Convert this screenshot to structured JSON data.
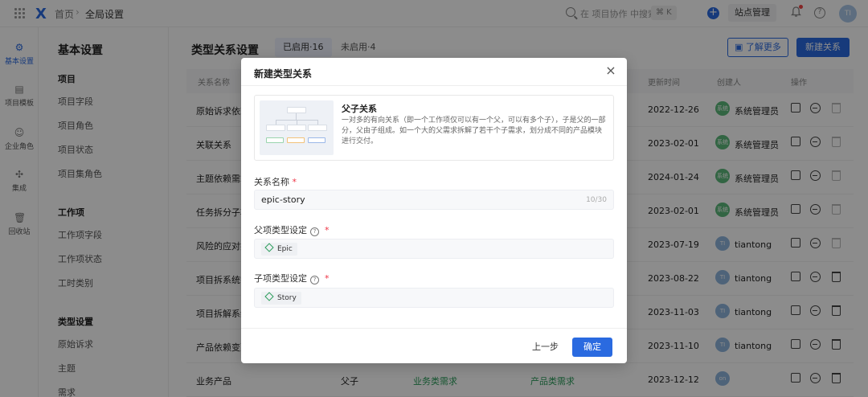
{
  "topbar": {
    "logo": "X",
    "breadcrumb_home": "首页",
    "breadcrumb_sep": "›",
    "breadcrumb_current": "全局设置",
    "search_placeholder": "在 项目协作 中搜索",
    "shortcut": "⌘ K",
    "plus": "+",
    "site_manage": "站点管理",
    "help": "?",
    "user_initials": "TI"
  },
  "rail": [
    {
      "label": "基本设置",
      "icon": "gear-icon",
      "glyph": "⚙",
      "active": true
    },
    {
      "label": "项目模板",
      "icon": "template-icon",
      "glyph": "▤",
      "active": false
    },
    {
      "label": "企业角色",
      "icon": "users-icon",
      "glyph": "☺",
      "active": false
    },
    {
      "label": "集成",
      "icon": "puzzle-icon",
      "glyph": "✣",
      "active": false
    },
    {
      "label": "回收站",
      "icon": "trash-icon",
      "glyph": "🗑",
      "active": false
    }
  ],
  "subnav": {
    "title": "基本设置",
    "groups": [
      {
        "name": "项目",
        "items": [
          "项目字段",
          "项目角色",
          "项目状态",
          "项目集角色"
        ]
      },
      {
        "name": "工作项",
        "items": [
          "工作项字段",
          "工作项状态",
          "工时类别"
        ]
      },
      {
        "name": "类型设置",
        "items": [
          "原始诉求",
          "主题",
          "需求"
        ]
      }
    ]
  },
  "main": {
    "title": "类型关系设置",
    "tab_enabled": "已启用·16",
    "tab_disabled": "未启用·4",
    "learn_more": "了解更多",
    "new_relation": "新建关系",
    "columns": {
      "name": "关系名称",
      "updated": "更新时间",
      "creator": "创建人",
      "ops": "操作"
    },
    "rows": [
      {
        "name": "原始诉求依赖",
        "rel": "",
        "parent": "",
        "child": "",
        "date": "2022-12-26",
        "av": "系统",
        "creator": "系统管理员",
        "av_color": "#5cb87a",
        "trash_dark": false
      },
      {
        "name": "关联关系",
        "rel": "",
        "parent": "",
        "child": "",
        "date": "2023-02-01",
        "av": "系统",
        "creator": "系统管理员",
        "av_color": "#5cb87a",
        "trash_dark": false
      },
      {
        "name": "主题依赖需求",
        "rel": "",
        "parent": "",
        "child": "",
        "date": "2024-01-24",
        "av": "系统",
        "creator": "系统管理员",
        "av_color": "#5cb87a",
        "trash_dark": false
      },
      {
        "name": "任务拆分子项",
        "rel": "",
        "parent": "",
        "child": "",
        "date": "2023-02-01",
        "av": "系统",
        "creator": "系统管理员",
        "av_color": "#5cb87a",
        "trash_dark": false
      },
      {
        "name": "风险的应对措施",
        "rel": "",
        "parent": "",
        "child": "",
        "date": "2023-07-19",
        "av": "TI",
        "creator": "tiantong",
        "av_color": "#8fb4dd",
        "trash_dark": false
      },
      {
        "name": "项目拆系统需求",
        "rel": "",
        "parent": "",
        "child": "",
        "date": "2023-08-22",
        "av": "TI",
        "creator": "tiantong",
        "av_color": "#8fb4dd",
        "trash_dark": true
      },
      {
        "name": "项目拆解系统",
        "rel": "",
        "parent": "",
        "child": "",
        "date": "2023-11-03",
        "av": "TI",
        "creator": "tiantong",
        "av_color": "#8fb4dd",
        "trash_dark": true
      },
      {
        "name": "产品依赖变更",
        "rel": "",
        "parent": "",
        "child": "",
        "date": "2023-11-10",
        "av": "TI",
        "creator": "tiantong",
        "av_color": "#8fb4dd",
        "trash_dark": true
      },
      {
        "name": "业务产品",
        "rel": "父子",
        "parent": "业务类需求",
        "child": "产品类需求",
        "date": "2023-12-12",
        "av": "on",
        "creator": "",
        "av_color": "#8fb4dd",
        "trash_dark": true
      }
    ]
  },
  "modal": {
    "title": "新建类型关系",
    "close": "×",
    "card_title": "父子关系",
    "card_desc": "一对多的有向关系（即一个工作项仅可以有一个父，可以有多个子），子是父的一部分，父由子组成。如一个大的父需求拆解了若干个子需求，划分成不同的产品模块进行交付。",
    "name_label": "关系名称",
    "required_mark": "*",
    "name_value": "epic-story",
    "name_count": "10/30",
    "parent_label": "父项类型设定",
    "parent_value": "Epic",
    "child_label": "子项类型设定",
    "child_value": "Story",
    "prev": "上一步",
    "ok": "确定"
  }
}
